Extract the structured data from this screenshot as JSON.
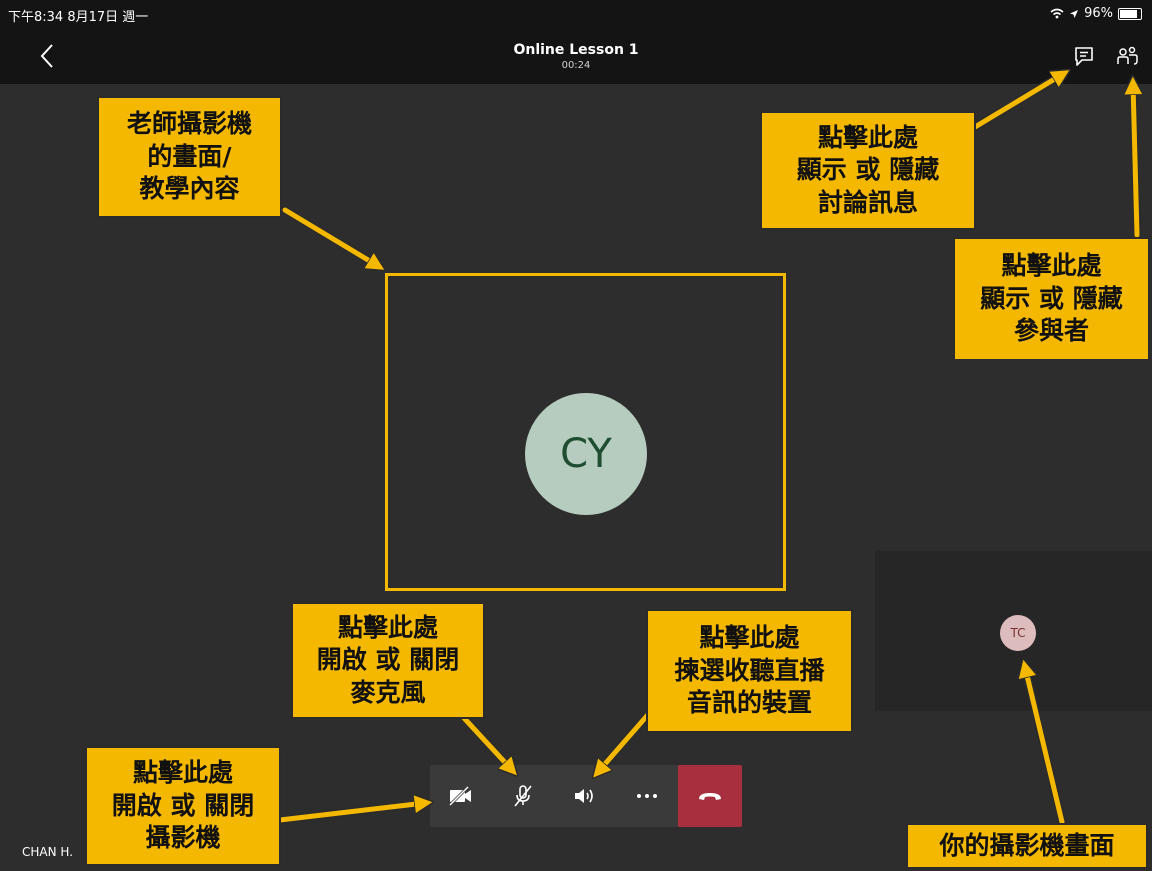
{
  "status_bar": {
    "time": "下午8:34  8月17日 週一",
    "battery": "96%",
    "battery_level": 0.96
  },
  "meeting": {
    "title": "Online Lesson 1",
    "timer": "00:24"
  },
  "icons": {
    "back": "chevron-left-icon",
    "chat": "chat-icon",
    "participants": "participants-icon",
    "camera_off": "camera-off-icon",
    "mic_off": "mic-off-icon",
    "speaker": "speaker-icon",
    "more": "more-icon",
    "hang_up": "hang-up-icon"
  },
  "participants": {
    "main_initials": "CY",
    "self_initials": "TC",
    "self_name": "CHAN H."
  },
  "annotations": {
    "teacher_video": [
      "老師攝影機",
      "的畫面/",
      "教學內容"
    ],
    "chat_toggle": [
      "點擊此處",
      "顯示 或 隱藏",
      "討論訊息"
    ],
    "participants_toggle": [
      "點擊此處",
      "顯示 或 隱藏",
      "參與者"
    ],
    "mic_toggle": [
      "點擊此處",
      "開啟 或 關閉",
      "麥克風"
    ],
    "audio_device": [
      "點擊此處",
      "揀選收聽直播",
      "音訊的裝置"
    ],
    "camera_toggle": [
      "點擊此處",
      "開啟 或 關閉",
      "攝影機"
    ],
    "self_view": "你的攝影機畫面"
  },
  "colors": {
    "background": "#2d2d2d",
    "bar": "#141414",
    "annotation": "#f5b800",
    "hang_up": "#a7303e",
    "main_avatar": "#b5ccbe",
    "self_avatar": "#dcbcbc"
  }
}
